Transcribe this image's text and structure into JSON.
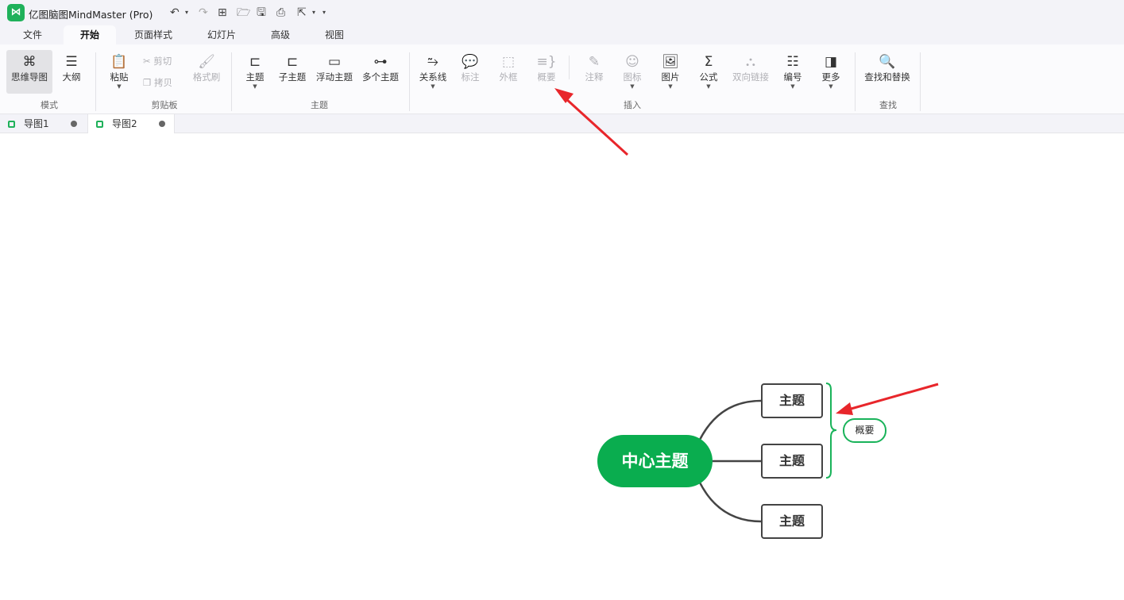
{
  "app": {
    "logo": "⋈",
    "title": "亿图脑图MindMaster (Pro)"
  },
  "quick_access": {
    "undo": "↶",
    "redo": "↷",
    "new": "⊞",
    "open": "🗁",
    "save": "🖫",
    "print": "⎙",
    "export": "⇱",
    "dropdown": "▾"
  },
  "menu_tabs": [
    "文件",
    "开始",
    "页面样式",
    "幻灯片",
    "高级",
    "视图"
  ],
  "active_menu_tab": "开始",
  "ribbon": {
    "mode": {
      "mindmap": "思维导图",
      "outline": "大纲",
      "group": "模式"
    },
    "clipboard": {
      "paste": "粘贴",
      "cut": "剪切",
      "copy": "拷贝",
      "format_painter": "格式刷",
      "group": "剪贴板"
    },
    "topic": {
      "topic": "主题",
      "subtopic": "子主题",
      "floating": "浮动主题",
      "multiple": "多个主题",
      "group": "主题"
    },
    "insert": {
      "relationship": "关系线",
      "callout": "标注",
      "boundary": "外框",
      "summary": "概要",
      "note": "注释",
      "icon": "图标",
      "image": "图片",
      "formula": "公式",
      "bidirectional_link": "双向链接",
      "numbering": "编号",
      "more": "更多",
      "group": "插入"
    },
    "find": {
      "find_replace": "查找和替换",
      "group": "查找"
    }
  },
  "doc_tabs": [
    "导图1",
    "导图2"
  ],
  "active_doc_tab": "导图2",
  "mindmap": {
    "central": "中心主题",
    "topics": [
      "主题",
      "主题",
      "主题"
    ],
    "summary": "概要"
  },
  "colors": {
    "brand": "#1fb15a",
    "central": "#0aad4f",
    "summary_border": "#19b35a",
    "annotation_arrow": "#e8262b"
  }
}
